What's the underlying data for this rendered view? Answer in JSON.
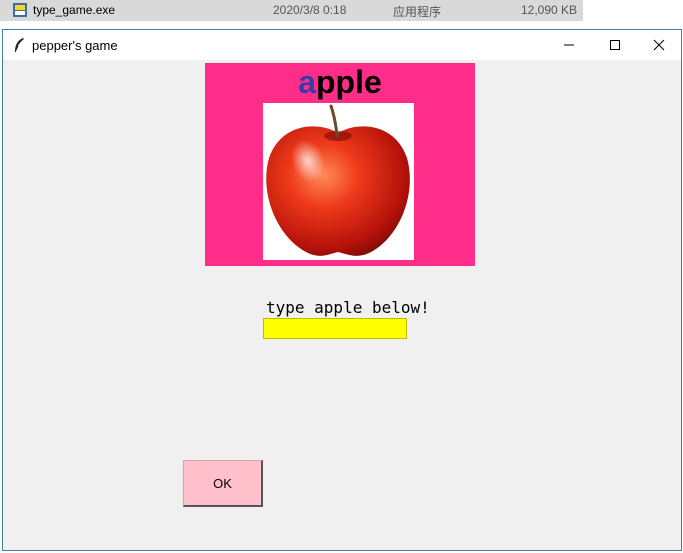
{
  "explorer_row": {
    "file_name": "type_game.exe",
    "modified": "2020/3/8 0:18",
    "file_type": "应用程序",
    "size": "12,090 KB",
    "icon": "python-exe-icon"
  },
  "window": {
    "title": "pepper's game",
    "title_icon": "feather-icon",
    "controls": [
      "minimize-icon",
      "maximize-icon",
      "close-icon"
    ]
  },
  "picture": {
    "word_first": "a",
    "word_rest": "pple",
    "image": "apple-image",
    "panel_color": "#ff2d8a",
    "highlight_color": "#3a3aa8"
  },
  "prompt": "type apple below!",
  "input": {
    "value": "",
    "background": "#ffff00"
  },
  "ok_button": {
    "label": "OK",
    "background": "#ffc0cb"
  }
}
